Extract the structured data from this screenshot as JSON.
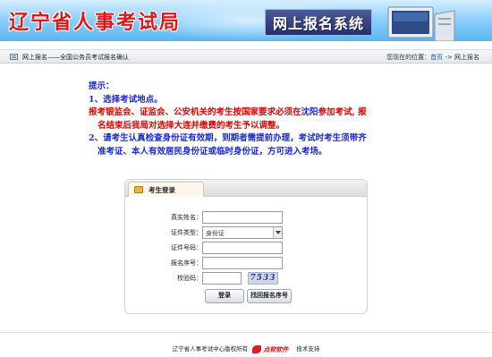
{
  "header": {
    "title": "辽宁省人事考试局",
    "system_name": "网上报名系统"
  },
  "navbar": {
    "title": "网上报名——全国公务员考试报名确认",
    "location_prefix": "您现在的位置：",
    "home_link": "首页",
    "separator": " -> ",
    "current": "网上报名"
  },
  "notice": {
    "heading": "提示：",
    "item1": "1、选择考试地点。",
    "item1_detail_a": "报考银监会、证监会、公安机关的考生按国家要求必须在",
    "item1_detail_city": "沈阳",
    "item1_detail_b": "参加考试, 报",
    "item1_detail_c": "名结束后我局对选择大连并缴费的考生予以调整。",
    "item2_a": "2、请考生认真检查身份证有效期，到期者需提前办理，考试时考生须带齐",
    "item2_b": "准考证、本人有效居民身份证或临时身份证，方可进入考场。"
  },
  "login": {
    "tab_label": "考生登录",
    "name_label": "真实姓名：",
    "name_value": "",
    "id_type_label": "证件类型：",
    "id_type_selected": "身份证",
    "id_number_label": "证件号码：",
    "id_number_value": "",
    "reg_number_label": "报名序号：",
    "reg_number_value": "",
    "captcha_label": "校验码：",
    "captcha_value": "",
    "captcha_image_text": "7533",
    "login_button": "登录",
    "retrieve_button": "找回报名序号"
  },
  "footer": {
    "copyright": "辽宁省人事考试中心版权所有",
    "vendor": "点软软件",
    "support": "技术支持"
  },
  "colors": {
    "title_red": "#e01717",
    "notice_red": "#e00000",
    "notice_blue": "#1a28d6",
    "link_blue": "#1a56c7",
    "banner_blue": "#5ab6f2"
  }
}
